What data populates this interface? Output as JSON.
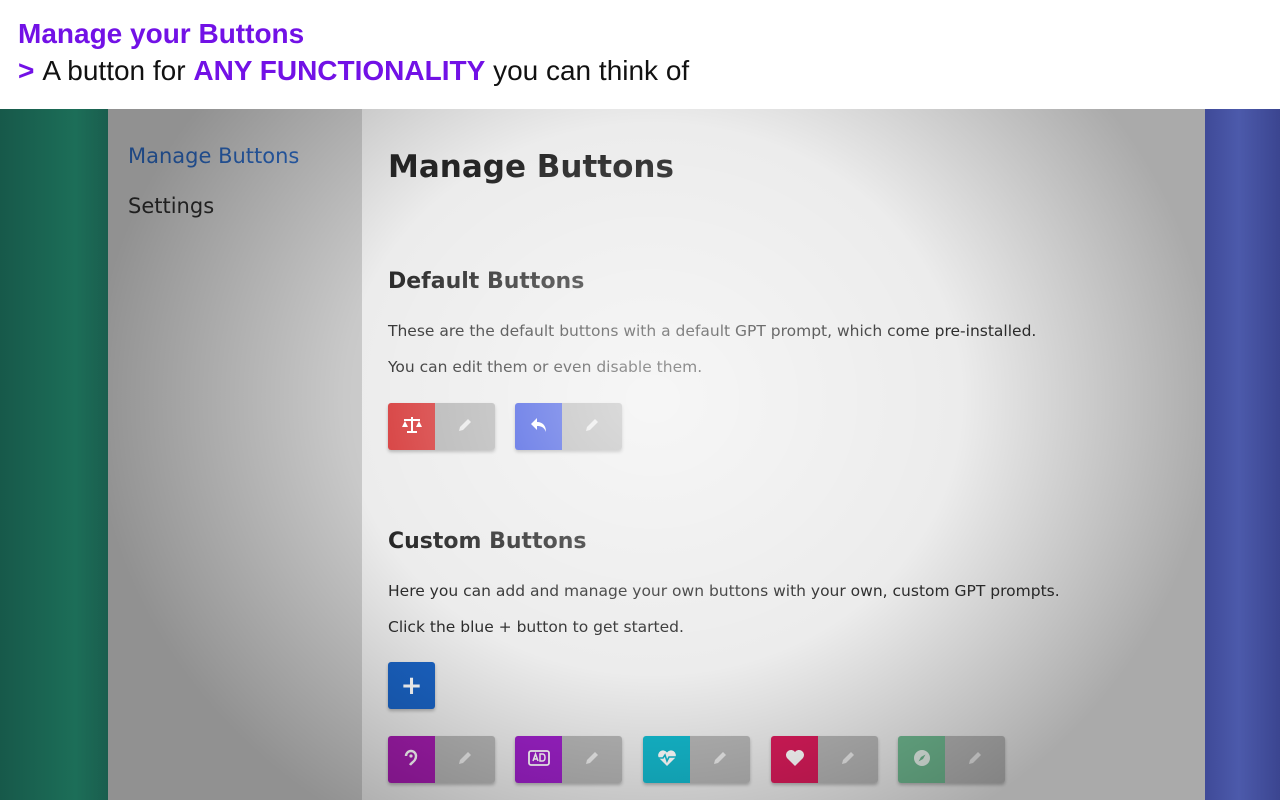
{
  "banner": {
    "title": "Manage your Buttons",
    "arrow": ">",
    "line_prefix": "A button for",
    "line_highlight": "ANY FUNCTIONALITY",
    "line_suffix": "you can think of"
  },
  "sidebar": {
    "items": [
      {
        "label": "Manage Buttons",
        "active": true
      },
      {
        "label": "Settings",
        "active": false
      }
    ]
  },
  "main": {
    "title": "Manage Buttons",
    "default_section": {
      "title": "Default Buttons",
      "desc1": "These are the default buttons with a default GPT prompt, which come pre-installed.",
      "desc2": "You can edit them or even disable them.",
      "buttons": [
        {
          "icon": "scale-icon",
          "color": "#d63b3b"
        },
        {
          "icon": "reply-icon",
          "color": "#3d55e0"
        }
      ]
    },
    "custom_section": {
      "title": "Custom Buttons",
      "desc1": "Here you can add and manage your own buttons with your own, custom GPT prompts.",
      "desc2": "Click the blue + button to get started.",
      "add_label": "+",
      "buttons": [
        {
          "icon": "hearing-icon",
          "color": "#a21cad"
        },
        {
          "icon": "ad-icon",
          "color": "#9b20c6"
        },
        {
          "icon": "heart-pulse-icon",
          "color": "#14b8cc"
        },
        {
          "icon": "heart-icon",
          "color": "#d81b5a"
        },
        {
          "icon": "compass-icon",
          "color": "#6fb890"
        }
      ]
    }
  }
}
